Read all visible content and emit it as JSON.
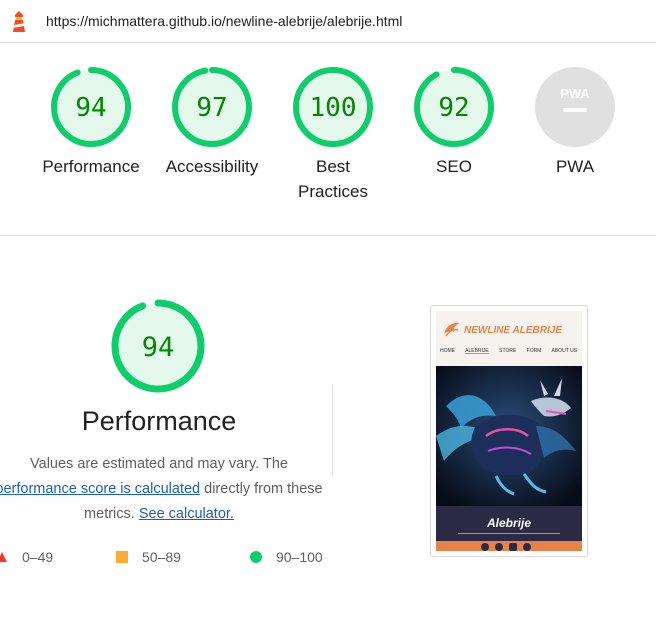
{
  "url_bar": {
    "url": "https://michmattera.github.io/newline-alebrije/alebrije.html",
    "icon": "lighthouse-icon"
  },
  "gauges": [
    {
      "score": "94",
      "label": "Performance",
      "value": 0.94
    },
    {
      "score": "97",
      "label": "Accessibility",
      "value": 0.97
    },
    {
      "score": "100",
      "label": "Best Practices",
      "label_lines": [
        "Best",
        "Practices"
      ],
      "value": 1.0
    },
    {
      "score": "92",
      "label": "SEO",
      "value": 0.92
    },
    {
      "score": "",
      "label": "PWA",
      "badge": "PWA"
    }
  ],
  "performance": {
    "score": "94",
    "value": 0.94,
    "title": "Performance",
    "desc_prefix": "Values are estimated and may vary. The",
    "link_score": "performance score is calculated",
    "desc_middle": "directly from these",
    "desc_suffix": "metrics.",
    "link_calc": "See calculator."
  },
  "legend": [
    {
      "range": "0–49",
      "shape": "triangle",
      "color": "#ff3333"
    },
    {
      "range": "50–89",
      "shape": "square",
      "color": "#ffaa33"
    },
    {
      "range": "90–100",
      "shape": "circle",
      "color": "#0cce6b"
    }
  ],
  "thumbnail": {
    "brand": "NEWLINE ALEBRIJE",
    "nav": [
      "HOME",
      "ALEBRIJE",
      "STORE",
      "FORM",
      "ABOUT US"
    ],
    "caption": "Alebrije"
  },
  "colors": {
    "pass": "#0cce6b",
    "pass_bg": "#e5f8ec",
    "score_text": "#008800",
    "pwa_grey": "#e0e0e0",
    "link": "#1a5ec8",
    "accent": "#e9824a"
  }
}
